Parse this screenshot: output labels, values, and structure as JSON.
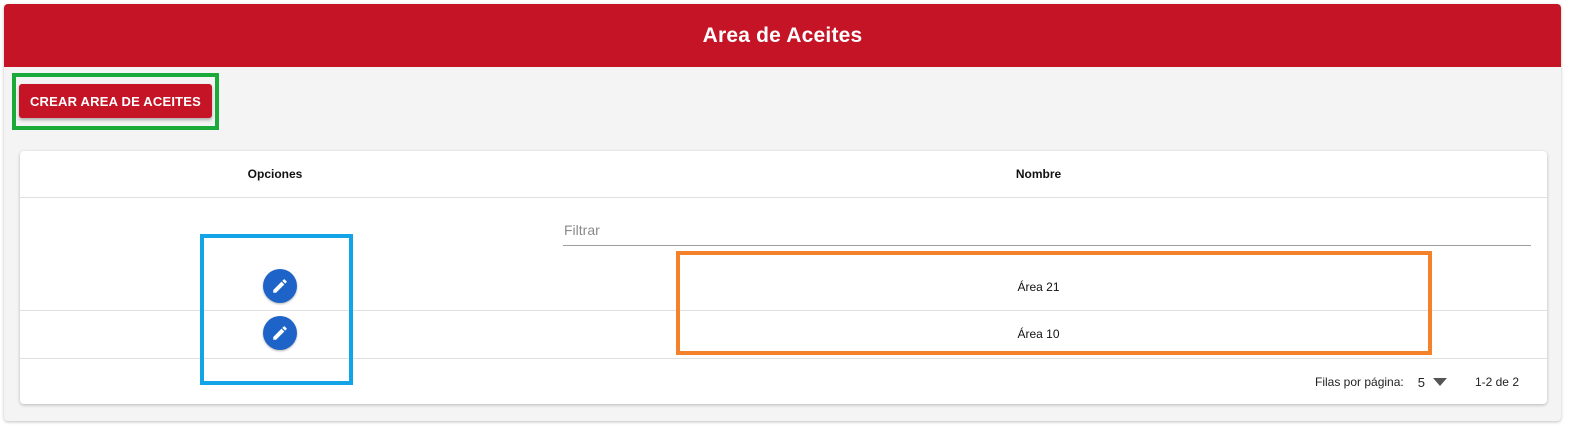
{
  "header": {
    "title": "Area de Aceites"
  },
  "toolbar": {
    "create_label": "CREAR AREA DE ACEITES"
  },
  "table": {
    "columns": [
      "Opciones",
      "Nombre"
    ],
    "filter_placeholder": "Filtrar",
    "rows": [
      {
        "nombre": "Área 21",
        "action_icon": "pencil-icon"
      },
      {
        "nombre": "Área 10",
        "action_icon": "pencil-icon"
      }
    ]
  },
  "pagination": {
    "rows_per_page_label": "Filas por página:",
    "rows_per_page_value": "5",
    "range_label": "1-2 de 2"
  },
  "colors": {
    "brand_red": "#c41425",
    "edit_blue": "#1e64c8",
    "highlight_green": "#1aaa3a",
    "highlight_blue": "#12a4e6",
    "highlight_orange": "#f5822a"
  }
}
